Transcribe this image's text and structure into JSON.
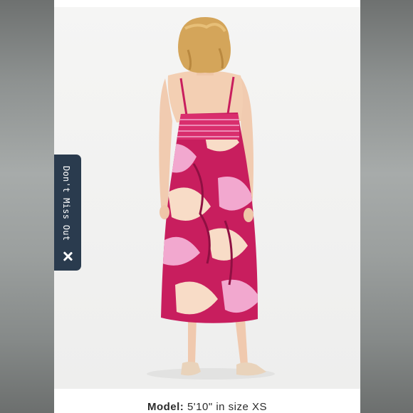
{
  "listing": {
    "image_alt": "Model wearing pink floral print midi dress, back view",
    "caption_label": "Model:",
    "caption_value": "5'10\" in size XS"
  },
  "promo_tab": {
    "label": "Don't Miss Out",
    "close_icon": "close-icon"
  },
  "colors": {
    "dress_base": "#c81e5e",
    "dress_light": "#f2a8cf",
    "dress_cream": "#f8dcc7",
    "tab_background": "#2a3b4e",
    "hair": "#d4a55a"
  }
}
